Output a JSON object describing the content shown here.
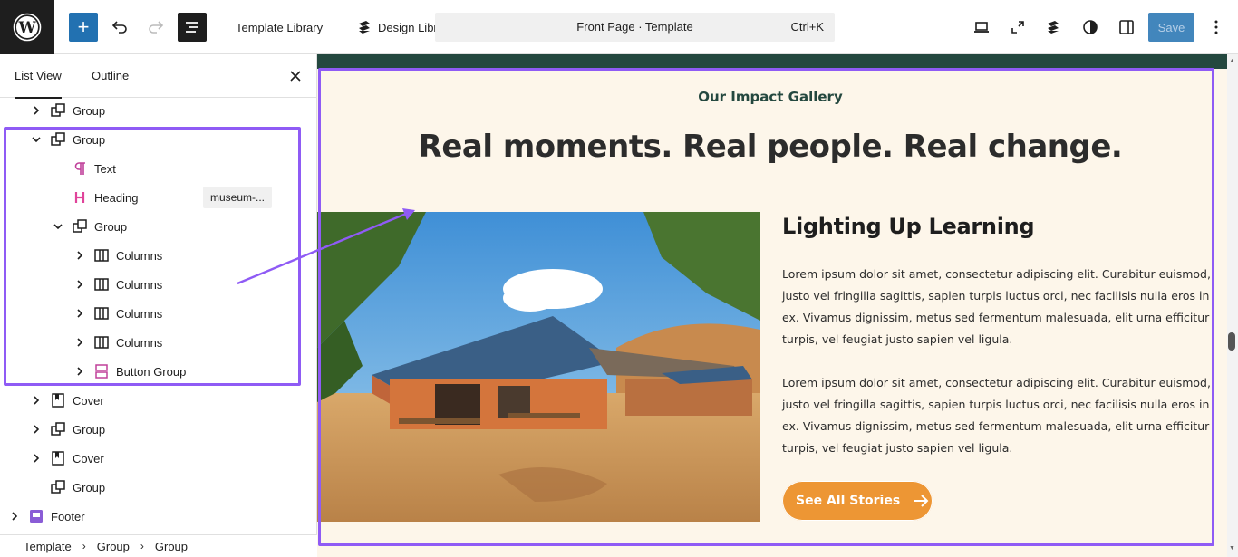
{
  "topbar": {
    "template_library": "Template Library",
    "design_library": "Design Library",
    "command_title": "Front Page · Template",
    "command_shortcut": "Ctrl+K",
    "save_label": "Save"
  },
  "sidebar": {
    "tabs": [
      "List View",
      "Outline"
    ],
    "tree": [
      {
        "label": "Group",
        "icon": "group-icon",
        "expanded": false
      },
      {
        "label": "Group",
        "icon": "group-icon",
        "expanded": true
      },
      {
        "label": "Text",
        "icon": "paragraph-icon"
      },
      {
        "label": "Heading",
        "icon": "heading-icon",
        "badge": "museum-..."
      },
      {
        "label": "Group",
        "icon": "group-icon",
        "expanded": true
      },
      {
        "label": "Columns",
        "icon": "columns-icon",
        "expanded": false
      },
      {
        "label": "Columns",
        "icon": "columns-icon",
        "expanded": false
      },
      {
        "label": "Columns",
        "icon": "columns-icon",
        "expanded": false
      },
      {
        "label": "Columns",
        "icon": "columns-icon",
        "expanded": false
      },
      {
        "label": "Button Group",
        "icon": "buttons-icon",
        "expanded": false
      },
      {
        "label": "Cover",
        "icon": "cover-icon",
        "expanded": false
      },
      {
        "label": "Group",
        "icon": "group-icon",
        "expanded": false
      },
      {
        "label": "Cover",
        "icon": "cover-icon",
        "expanded": false
      },
      {
        "label": "Group",
        "icon": "group-icon"
      },
      {
        "label": "Footer",
        "icon": "template-part-icon",
        "expanded": false
      }
    ]
  },
  "breadcrumb": [
    "Template",
    "Group",
    "Group"
  ],
  "canvas": {
    "eyebrow": "Our Impact Gallery",
    "headline": "Real moments. Real people. Real change.",
    "story_title": "Lighting Up Learning",
    "para1": "Lorem ipsum dolor sit amet, consectetur adipiscing elit. Curabitur euismod, justo vel fringilla sagittis, sapien turpis luctus orci, nec facilisis nulla eros in ex. Vivamus dignissim, metus sed fermentum malesuada, elit urna efficitur turpis, vel feugiat justo sapien vel ligula.",
    "para2": "Lorem ipsum dolor sit amet, consectetur adipiscing elit. Curabitur euismod, justo vel fringilla sagittis, sapien turpis luctus orci, nec facilisis nulla eros in ex. Vivamus dignissim, metus sed fermentum malesuada, elit urna efficitur turpis, vel feugiat justo sapien vel ligula.",
    "cta_label": "See All Stories"
  },
  "colors": {
    "accent": "#2271b1",
    "highlight": "#8f5bf5",
    "brand_green": "#24483f",
    "cta_orange": "#ed9634",
    "canvas_bg": "#fdf6ea"
  }
}
